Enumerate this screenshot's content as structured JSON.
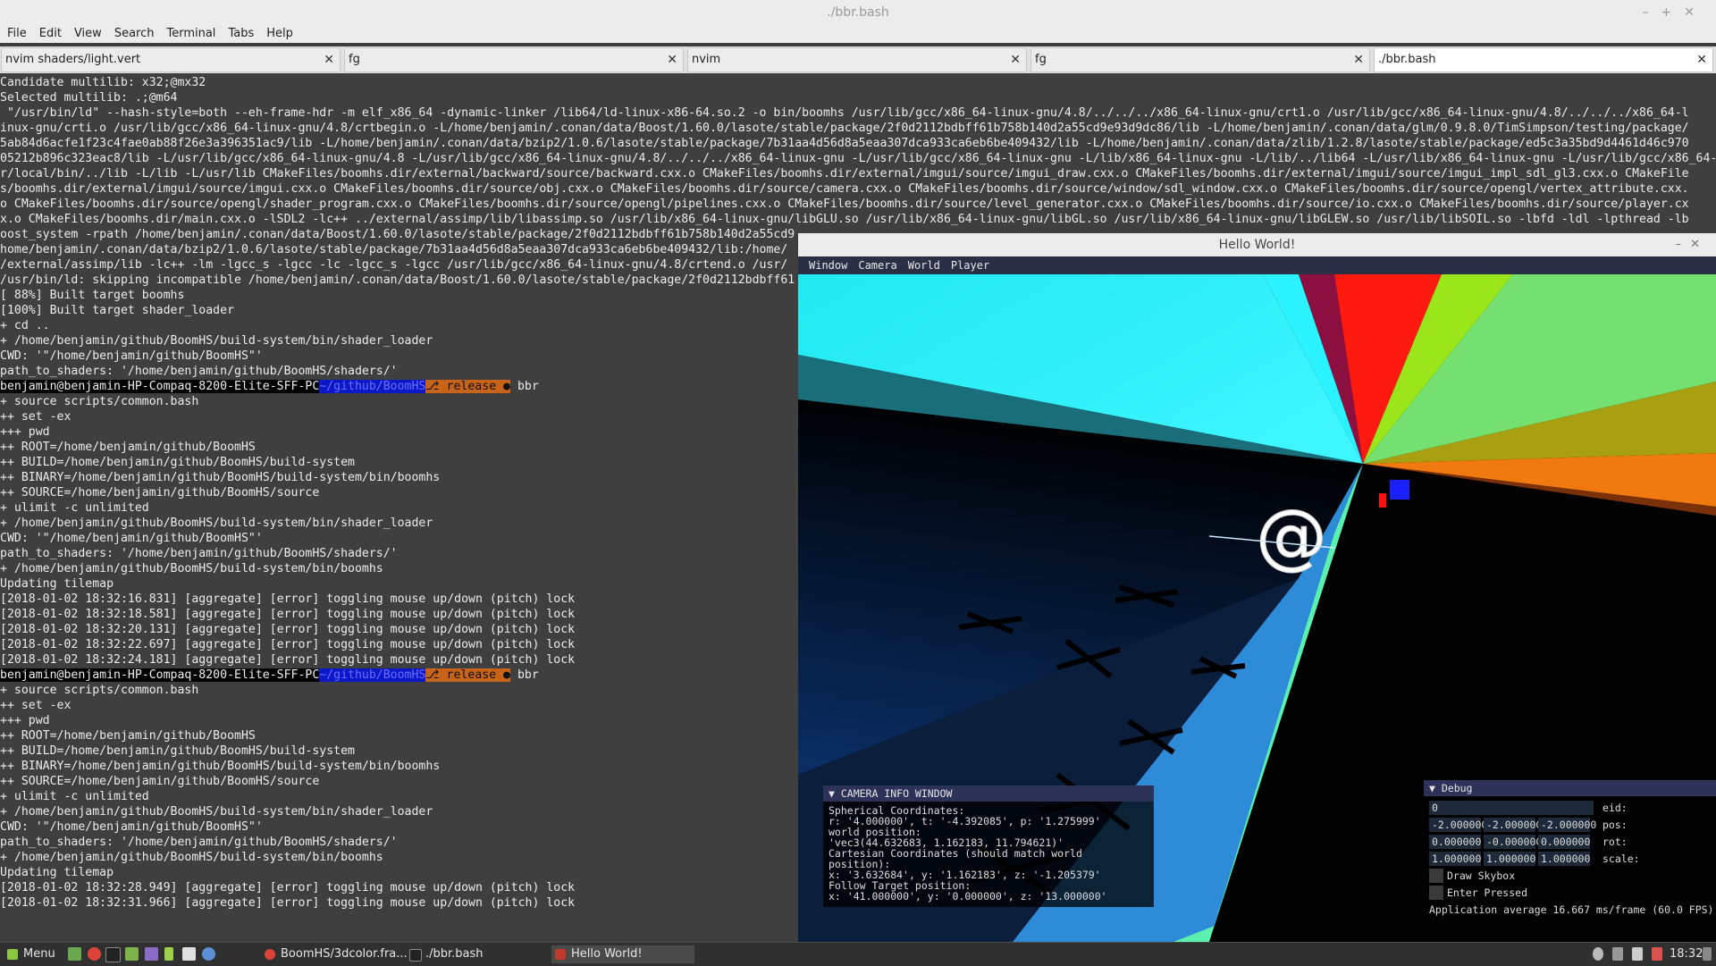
{
  "window_title": "./bbr.bash",
  "menu": [
    "File",
    "Edit",
    "View",
    "Search",
    "Terminal",
    "Tabs",
    "Help"
  ],
  "tabs": [
    {
      "label": "nvim shaders/light.vert",
      "active": false
    },
    {
      "label": "fg",
      "active": false
    },
    {
      "label": "nvim",
      "active": false
    },
    {
      "label": "fg",
      "active": false
    },
    {
      "label": "./bbr.bash",
      "active": true
    }
  ],
  "tab_close_glyph": "✕",
  "prompt": {
    "user": "benjamin@benjamin-HP-Compaq-8200-Elite-SFF-PC",
    "path": "~/github/BoomHS",
    "branch": "⎇ release ●",
    "cmd": "bbr"
  },
  "terminal_lines": [
    "Candidate multilib: x32;@mx32",
    "Selected multilib: .;@m64",
    " \"/usr/bin/ld\" --hash-style=both --eh-frame-hdr -m elf_x86_64 -dynamic-linker /lib64/ld-linux-x86-64.so.2 -o bin/boomhs /usr/lib/gcc/x86_64-linux-gnu/4.8/../../../x86_64-linux-gnu/crt1.o /usr/lib/gcc/x86_64-linux-gnu/4.8/../../../x86_64-l",
    "inux-gnu/crti.o /usr/lib/gcc/x86_64-linux-gnu/4.8/crtbegin.o -L/home/benjamin/.conan/data/Boost/1.60.0/lasote/stable/package/2f0d2112bdbff61b758b140d2a55cd9e93d9dc86/lib -L/home/benjamin/.conan/data/glm/0.9.8.0/TimSimpson/testing/package/",
    "5ab84d6acfe1f23c4fae0ab88f26e3a396351ac9/lib -L/home/benjamin/.conan/data/bzip2/1.0.6/lasote/stable/package/7b31aa4d56d8a5eaa307dca933ca6eb6be409432/lib -L/home/benjamin/.conan/data/zlib/1.2.8/lasote/stable/package/ed5c3a35bd9d4461d46c970",
    "05212b896c323eac8/lib -L/usr/lib/gcc/x86_64-linux-gnu/4.8 -L/usr/lib/gcc/x86_64-linux-gnu/4.8/../../../x86_64-linux-gnu -L/usr/lib/gcc/x86_64-linux-gnu -L/lib/x86_64-linux-gnu -L/lib/../lib64 -L/usr/lib/x86_64-linux-gnu -L/usr/lib/gcc/x86_64-linux-gnu/4.8/../../.. -L/us",
    "r/local/bin/../lib -L/lib -L/usr/lib CMakeFiles/boomhs.dir/external/backward/source/backward.cxx.o CMakeFiles/boomhs.dir/external/imgui/source/imgui_draw.cxx.o CMakeFiles/boomhs.dir/external/imgui/source/imgui_impl_sdl_gl3.cxx.o CMakeFile",
    "s/boomhs.dir/external/imgui/source/imgui.cxx.o CMakeFiles/boomhs.dir/source/obj.cxx.o CMakeFiles/boomhs.dir/source/camera.cxx.o CMakeFiles/boomhs.dir/source/window/sdl_window.cxx.o CMakeFiles/boomhs.dir/source/opengl/vertex_attribute.cxx.",
    "o CMakeFiles/boomhs.dir/source/opengl/shader_program.cxx.o CMakeFiles/boomhs.dir/source/opengl/pipelines.cxx.o CMakeFiles/boomhs.dir/source/level_generator.cxx.o CMakeFiles/boomhs.dir/source/io.cxx.o CMakeFiles/boomhs.dir/source/player.cx",
    "x.o CMakeFiles/boomhs.dir/main.cxx.o -lSDL2 -lc++ ../external/assimp/lib/libassimp.so /usr/lib/x86_64-linux-gnu/libGLU.so /usr/lib/x86_64-linux-gnu/libGL.so /usr/lib/x86_64-linux-gnu/libGLEW.so /usr/lib/libSOIL.so -lbfd -ldl -lpthread -lb",
    "oost_system -rpath /home/benjamin/.conan/data/Boost/1.60.0/lasote/stable/package/2f0d2112bdbff61b758b140d2a55cd9",
    "home/benjamin/.conan/data/bzip2/1.0.6/lasote/stable/package/7b31aa4d56d8a5eaa307dca933ca6eb6be409432/lib:/home/",
    "/external/assimp/lib -lc++ -lm -lgcc_s -lgcc -lc -lgcc_s -lgcc /usr/lib/gcc/x86_64-linux-gnu/4.8/crtend.o /usr/",
    "/usr/bin/ld: skipping incompatible /home/benjamin/.conan/data/Boost/1.60.0/lasote/stable/package/2f0d2112bdbff61",
    "[ 88%] Built target boomhs",
    "[100%] Built target shader_loader",
    "+ cd ..",
    "+ /home/benjamin/github/BoomHS/build-system/bin/shader_loader",
    "CWD: '\"/home/benjamin/github/BoomHS\"'",
    "path_to_shaders: '/home/benjamin/github/BoomHS/shaders/'",
    "",
    "+ source scripts/common.bash",
    "++ set -ex",
    "+++ pwd",
    "++ ROOT=/home/benjamin/github/BoomHS",
    "++ BUILD=/home/benjamin/github/BoomHS/build-system",
    "++ BINARY=/home/benjamin/github/BoomHS/build-system/bin/boomhs",
    "++ SOURCE=/home/benjamin/github/BoomHS/source",
    "+ ulimit -c unlimited",
    "+ /home/benjamin/github/BoomHS/build-system/bin/shader_loader",
    "CWD: '\"/home/benjamin/github/BoomHS\"'",
    "path_to_shaders: '/home/benjamin/github/BoomHS/shaders/'",
    "+ /home/benjamin/github/BoomHS/build-system/bin/boomhs",
    "Updating tilemap",
    "[2018-01-02 18:32:16.831] [aggregate] [error] toggling mouse up/down (pitch) lock",
    "[2018-01-02 18:32:18.581] [aggregate] [error] toggling mouse up/down (pitch) lock",
    "[2018-01-02 18:32:20.131] [aggregate] [error] toggling mouse up/down (pitch) lock",
    "[2018-01-02 18:32:22.697] [aggregate] [error] toggling mouse up/down (pitch) lock",
    "[2018-01-02 18:32:24.181] [aggregate] [error] toggling mouse up/down (pitch) lock",
    "",
    "+ source scripts/common.bash",
    "++ set -ex",
    "+++ pwd",
    "++ ROOT=/home/benjamin/github/BoomHS",
    "++ BUILD=/home/benjamin/github/BoomHS/build-system",
    "++ BINARY=/home/benjamin/github/BoomHS/build-system/bin/boomhs",
    "++ SOURCE=/home/benjamin/github/BoomHS/source",
    "+ ulimit -c unlimited",
    "+ /home/benjamin/github/BoomHS/build-system/bin/shader_loader",
    "CWD: '\"/home/benjamin/github/BoomHS\"'",
    "path_to_shaders: '/home/benjamin/github/BoomHS/shaders/'",
    "+ /home/benjamin/github/BoomHS/build-system/bin/boomhs",
    "Updating tilemap",
    "[2018-01-02 18:32:28.949] [aggregate] [error] toggling mouse up/down (pitch) lock",
    "[2018-01-02 18:32:31.966] [aggregate] [error] toggling mouse up/down (pitch) lock"
  ],
  "game": {
    "title": "Hello World!",
    "menu": [
      "Window",
      "Camera",
      "World",
      "Player"
    ],
    "camera_window": {
      "header": "▼ CAMERA INFO WINDOW",
      "lines": [
        "Spherical Coordinates:",
        "r: '4.000000', t: '-4.392085', p: '1.275999'",
        "world position:",
        "'vec3(44.632683, 1.162183, 11.794621)'",
        "Cartesian Coordinates (should match world position):",
        "x: '3.632684', y: '1.162183', z: '-1.205379'",
        "Follow Target position:",
        "x: '41.000000', y: '0.000000', z: '13.000000'"
      ]
    },
    "debug_window": {
      "header": "▼ Debug",
      "eid_value": "0",
      "eid_label": "eid:",
      "pos": [
        "-2.000000",
        "-2.000000",
        "-2.000000"
      ],
      "pos_label": "pos:",
      "rot": [
        "0.000000",
        "-0.000000",
        "0.000000"
      ],
      "rot_label": "rot:",
      "scale": [
        "1.000000",
        "1.000000",
        "1.000000"
      ],
      "scale_label": "scale:",
      "draw_skybox": "Draw Skybox",
      "enter_pressed": "Enter Pressed",
      "app_avg": "Application average 16.667 ms/frame (60.0 FPS)"
    }
  },
  "taskbar": {
    "menu_label": "Menu",
    "windows": [
      "BoomHS/3dcolor.fra...",
      "./bbr.bash",
      "Hello World!"
    ],
    "clock": "18:32"
  },
  "colors": {
    "terminal_bg": "#3f3f3f",
    "prompt_blue": "#0a18c8",
    "prompt_orange": "#c8641a",
    "imgui_header": "#2e3158"
  }
}
